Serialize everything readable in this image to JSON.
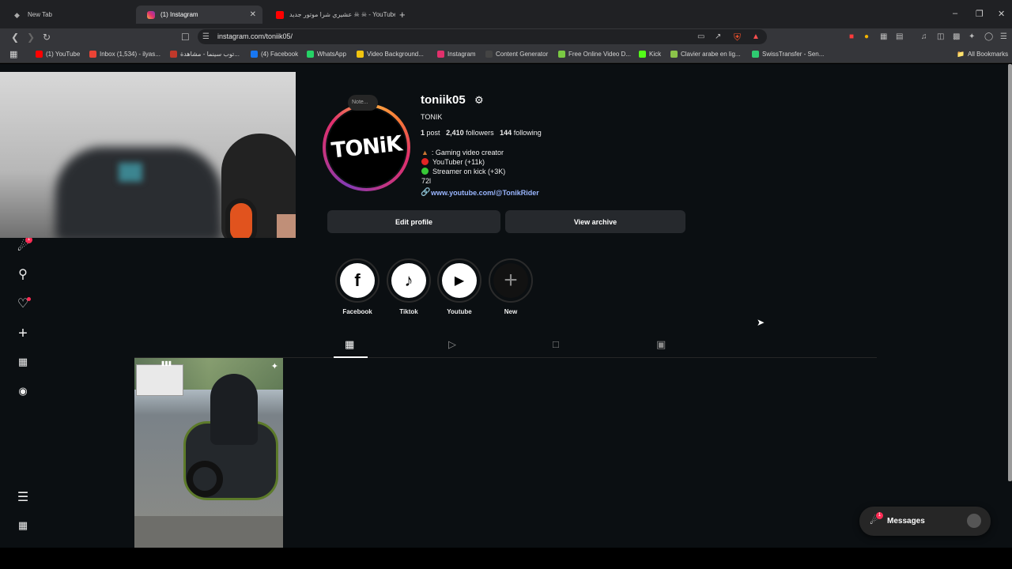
{
  "browser": {
    "tabs": [
      {
        "title": "New Tab"
      },
      {
        "title": "(1) Instagram"
      },
      {
        "title": "عشيري شرا موتور جديد ☠ ☠ - YouTube"
      }
    ],
    "url": "instagram.com/toniik05/",
    "bookmarks": [
      {
        "label": "(1) YouTube",
        "color": "#ff0000"
      },
      {
        "label": "Inbox (1,534) - ilyas...",
        "color": "#ea4335"
      },
      {
        "label": "توب سينما - مشاهدة...",
        "color": "#c0392b"
      },
      {
        "label": "(4) Facebook",
        "color": "#1877f2"
      },
      {
        "label": "WhatsApp",
        "color": "#25d366"
      },
      {
        "label": "Video Background...",
        "color": "#f1c40f"
      },
      {
        "label": "Instagram",
        "color": "#e1306c"
      },
      {
        "label": "Content Generator",
        "color": "#444444"
      },
      {
        "label": "Free Online Video D...",
        "color": "#7ac943"
      },
      {
        "label": "Kick",
        "color": "#53fc18"
      },
      {
        "label": "Clavier arabe en lig...",
        "color": "#8bc34a"
      },
      {
        "label": "SwissTransfer - Sen...",
        "color": "#2ecc71"
      }
    ],
    "all_bookmarks": "All Bookmarks"
  },
  "profile": {
    "note": "Note...",
    "username": "toniik05",
    "avatar_text": "TONiK",
    "full_name": "TONIK",
    "stats": {
      "posts": "1",
      "posts_label": "post",
      "followers": "2,410",
      "followers_label": "followers",
      "following": "144",
      "following_label": "following"
    },
    "bio": {
      "line1": ": Gaming video creator",
      "line2": "YouTuber (+11k)",
      "line3": "Streamer on kick (+3K)",
      "line4": "72l"
    },
    "link": "www.youtube.com/@TonikRider",
    "edit_button": "Edit profile",
    "archive_button": "View archive"
  },
  "highlights": [
    {
      "label": "Facebook",
      "icon": "f"
    },
    {
      "label": "Tiktok",
      "icon": "♪"
    },
    {
      "label": "Youtube",
      "icon": "▶"
    },
    {
      "label": "New",
      "icon": "+"
    }
  ],
  "sidebar": {
    "notification_badge": "1"
  },
  "messages": {
    "label": "Messages",
    "badge": "1"
  }
}
